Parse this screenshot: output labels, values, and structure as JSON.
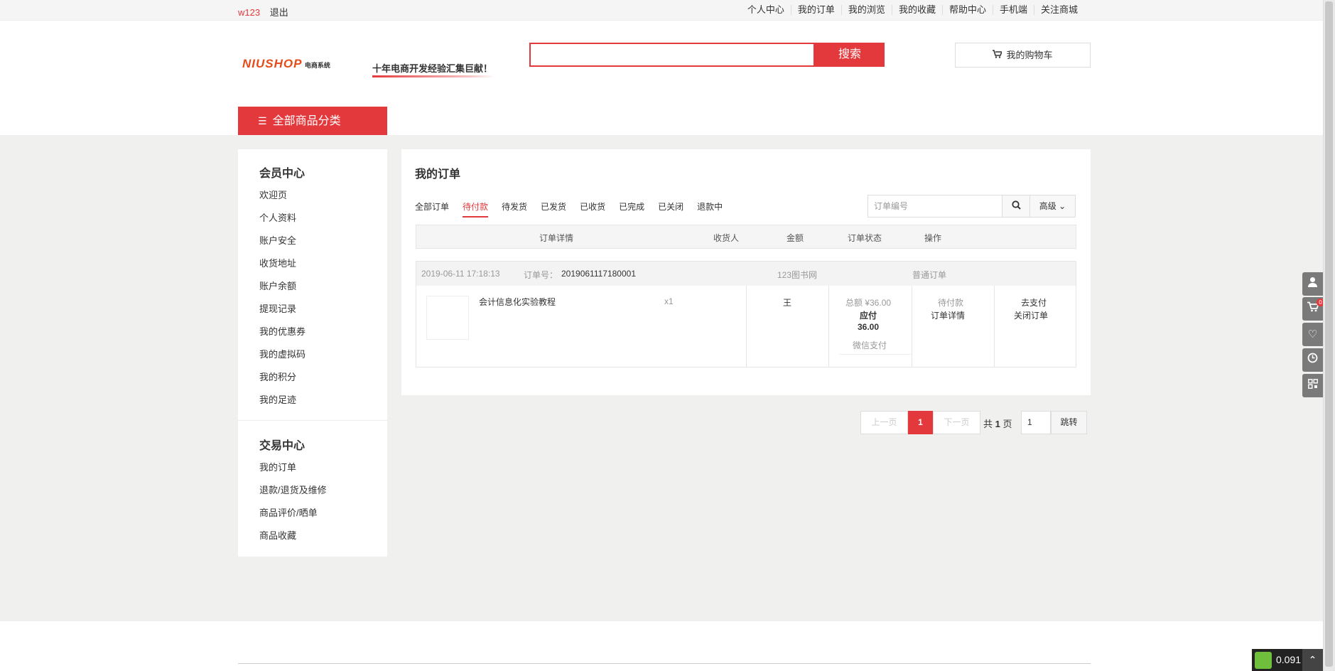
{
  "topbar": {
    "username": "w123",
    "logout": "退出",
    "links": [
      "个人中心",
      "我的订单",
      "我的浏览",
      "我的收藏",
      "帮助中心",
      "手机端",
      "关注商城"
    ]
  },
  "header": {
    "logo_main": "NIUSHOP",
    "logo_sub": "电商系统",
    "slogan": "十年电商开发经验汇集巨献！",
    "search_placeholder": "",
    "search_btn": "搜索",
    "cart": "我的购物车",
    "categories": "全部商品分类"
  },
  "sidebar": {
    "member_title": "会员中心",
    "member_items": [
      "欢迎页",
      "个人资料",
      "账户安全",
      "收货地址",
      "账户余额",
      "提现记录",
      "我的优惠券",
      "我的虚拟码",
      "我的积分",
      "我的足迹"
    ],
    "trade_title": "交易中心",
    "trade_items": [
      "我的订单",
      "退款/退货及维修",
      "商品评价/晒单",
      "商品收藏"
    ]
  },
  "main": {
    "title": "我的订单",
    "tabs": [
      "全部订单",
      "待付款",
      "待发货",
      "已发货",
      "已收货",
      "已完成",
      "已关闭",
      "退款中"
    ],
    "active_tab": "待付款",
    "order_search_placeholder": "订单编号",
    "advanced": "高级",
    "headers": [
      "订单详情",
      "收货人",
      "金额",
      "订单状态",
      "操作"
    ]
  },
  "order": {
    "time": "2019-06-11 17:18:13",
    "number_label": "订单号：",
    "number": "2019061117180001",
    "shop": "123图书网",
    "type": "普通订单",
    "product": "会计信息化实验教程",
    "qty": "x1",
    "receiver": "王",
    "total": "总额 ¥36.00",
    "payable_label": "应付",
    "payable": "36.00",
    "pay_method": "微信支付",
    "status": "待付款",
    "detail_link": "订单详情",
    "action_pay": "去支付",
    "action_close": "关闭订单"
  },
  "pager": {
    "prev": "上一页",
    "current": "1",
    "next": "下一页",
    "total_prefix": "共",
    "total": "1",
    "total_suffix": "页",
    "jump_value": "1",
    "jump": "跳转"
  },
  "rail": {
    "cart_count": "0",
    "badge_text": "0.091"
  },
  "colors": {
    "accent": "#e4393c",
    "gray_bg": "#f0f1ef"
  }
}
